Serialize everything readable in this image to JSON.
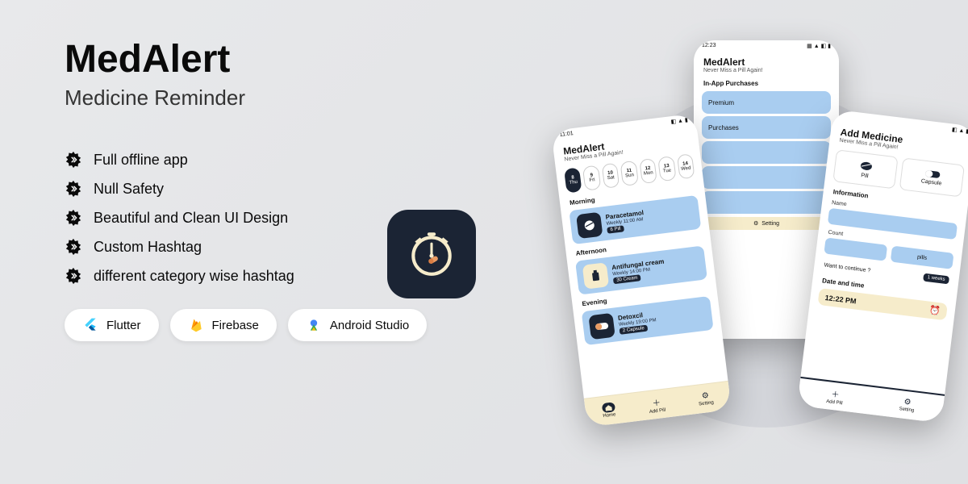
{
  "hero": {
    "title": "MedAlert",
    "subtitle": "Medicine Reminder"
  },
  "features": [
    "Full offline app",
    "Null Safety",
    "Beautiful and Clean UI Design",
    "Custom Hashtag",
    "different category wise hashtag"
  ],
  "techChips": [
    {
      "name": "flutter",
      "label": "Flutter"
    },
    {
      "name": "firebase",
      "label": "Firebase"
    },
    {
      "name": "android-studio",
      "label": "Android Studio"
    }
  ],
  "appIcon": {
    "name": "medalert-app-icon"
  },
  "phones": {
    "home": {
      "statusTime": "11:01",
      "title": "MedAlert",
      "tagline": "Never Miss a Pill Again!",
      "dates": [
        {
          "num": "8",
          "day": "Thu",
          "selected": true
        },
        {
          "num": "9",
          "day": "Fri"
        },
        {
          "num": "10",
          "day": "Sat"
        },
        {
          "num": "11",
          "day": "Sun"
        },
        {
          "num": "12",
          "day": "Mon"
        },
        {
          "num": "13",
          "day": "Tue"
        },
        {
          "num": "14",
          "day": "Wed"
        }
      ],
      "sections": [
        {
          "label": "Morning",
          "med": {
            "name": "Paracetamol",
            "time": "Weekly 11:00 AM",
            "qty": "6 Pill",
            "iconStyle": "dark"
          }
        },
        {
          "label": "Afternoon",
          "med": {
            "name": "Antifungal cream",
            "time": "Weekly 14:00 PM",
            "qty": "30 Cream",
            "iconStyle": "cream"
          }
        },
        {
          "label": "Evening",
          "med": {
            "name": "Detoxcil",
            "time": "Weekly 19:00 PM",
            "qty": "2 Capsule",
            "iconStyle": "dark"
          }
        }
      ],
      "nav": [
        {
          "label": "Home",
          "active": true
        },
        {
          "label": "Add Pill"
        },
        {
          "label": "Setting"
        }
      ]
    },
    "purchases": {
      "statusTime": "12:23",
      "title": "MedAlert",
      "tagline": "Never Miss a Pill Again!",
      "heading": "In-App Purchases",
      "rows": [
        "Premium",
        "Purchases",
        "",
        "",
        ""
      ],
      "button": {
        "icon": "gear",
        "label": "Setting"
      }
    },
    "add": {
      "title": "Add Medicine",
      "tagline": "Never Miss a Pill Again!",
      "types": [
        {
          "label": "Pill"
        },
        {
          "label": "Capsule"
        }
      ],
      "infoHeading": "Information",
      "fields": {
        "name": "Name",
        "count": "Count",
        "unit": "pills"
      },
      "continue": {
        "question": "Want to continue ?",
        "chip": "1 weeks"
      },
      "timeHeading": "Date and time",
      "timeValue": "12:22 PM",
      "nav": [
        {
          "label": "Add Pill"
        },
        {
          "label": "Setting"
        }
      ]
    }
  }
}
